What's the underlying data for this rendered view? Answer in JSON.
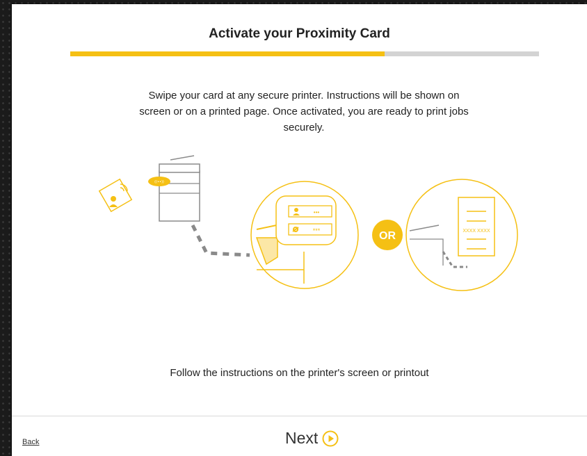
{
  "header": {
    "title": "Activate your Proximity Card"
  },
  "progress": {
    "fraction": 0.67
  },
  "main": {
    "instructions": "Swipe your card at any secure printer. Instructions will be shown on screen or on a printed page. Once activated, you are ready to print jobs securely.",
    "illustration": {
      "login_placeholder": "•••",
      "password_placeholder": "***",
      "or_label": "OR",
      "printout_code": "XXXX XXXX"
    },
    "footnote": "Follow the instructions on the printer's screen or printout"
  },
  "footer": {
    "back_label": "Back",
    "next_label": "Next"
  },
  "colors": {
    "accent": "#f5c014",
    "progress_track": "#d3d3d3",
    "panel": "#ffffff",
    "frame": "#1b1b1b"
  },
  "icons": {
    "next": "play-circle-icon"
  }
}
